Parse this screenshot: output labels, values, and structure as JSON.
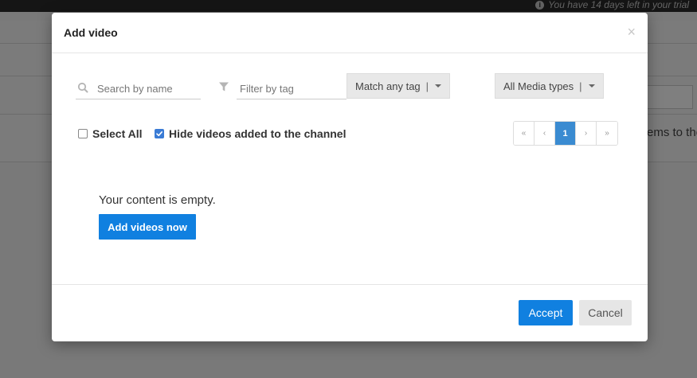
{
  "background": {
    "trial_text": "You have 14 days left in your trial",
    "partial_text": "ems to the"
  },
  "modal": {
    "title": "Add video",
    "close_glyph": "×",
    "search": {
      "placeholder": "Search by name",
      "value": ""
    },
    "tag_filter": {
      "placeholder": "Filter by tag",
      "value": ""
    },
    "match_dropdown": {
      "label": "Match any tag",
      "separator": "|"
    },
    "media_dropdown": {
      "label": "All Media types",
      "separator": "|"
    },
    "select_all": {
      "label": "Select All",
      "checked": false
    },
    "hide_added": {
      "label": "Hide videos added to the channel",
      "checked": true
    },
    "pagination": {
      "first": "«",
      "prev": "‹",
      "current": "1",
      "next": "›",
      "last": "»"
    },
    "empty_message": "Your content is empty.",
    "add_now_label": "Add videos now",
    "accept_label": "Accept",
    "cancel_label": "Cancel"
  },
  "icons": [
    "info-icon",
    "search-icon",
    "filter-icon",
    "caret-down-icon",
    "check-icon",
    "close-icon"
  ],
  "colors": {
    "primary": "#1080e0",
    "page_active": "#3a8bd1",
    "overlay": "rgba(0,0,0,0.5)"
  }
}
